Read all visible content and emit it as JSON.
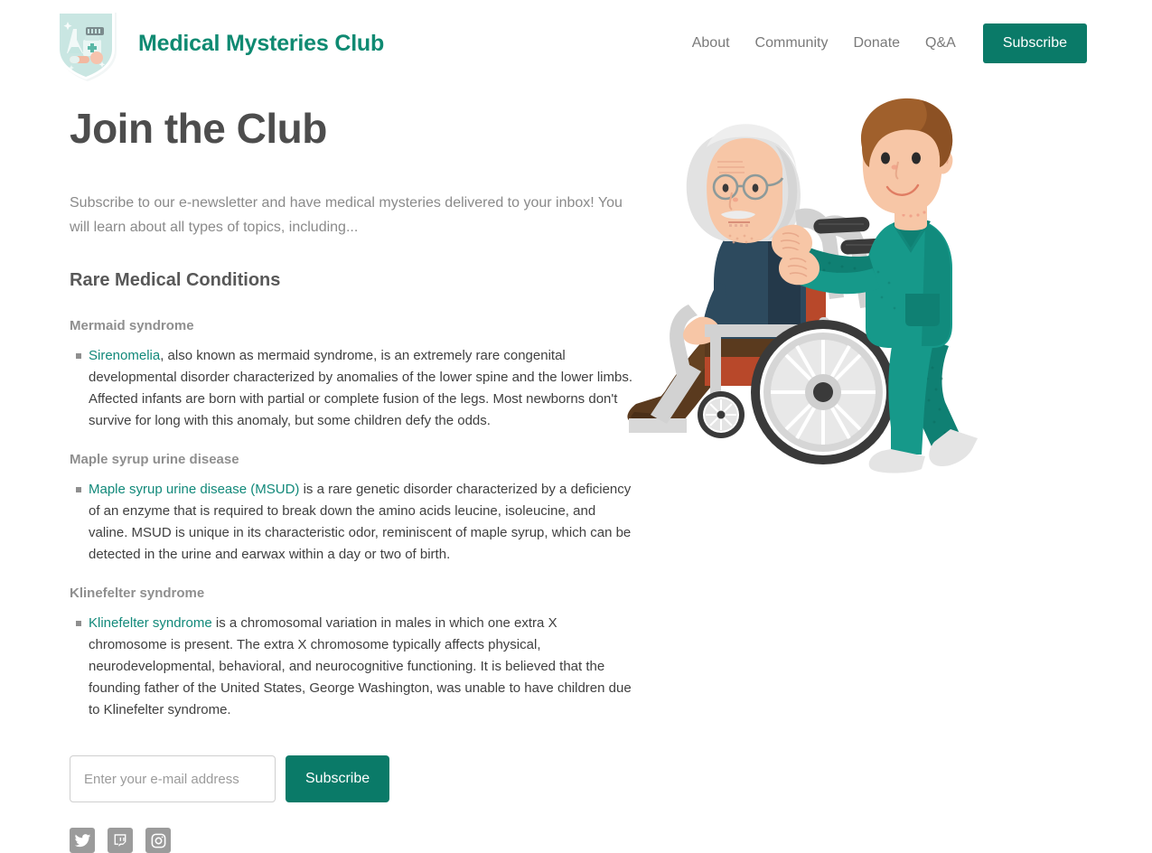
{
  "brand": {
    "name": "Medical Mysteries Club",
    "logo_icon": "medical-shield-badge-icon",
    "accent_color": "#0f8a72"
  },
  "nav": {
    "links": [
      {
        "label": "About"
      },
      {
        "label": "Community"
      },
      {
        "label": "Donate"
      },
      {
        "label": "Q&A"
      }
    ],
    "cta": {
      "label": "Subscribe",
      "bg_color": "#0a7a68",
      "text_color": "#ffffff"
    }
  },
  "main": {
    "title": "Join the Club",
    "lede": "Subscribe to our e-newsletter and have medical mysteries delivered to your inbox! You will learn about all types of topics, including...",
    "section_title": "Rare Medical Conditions",
    "conditions": [
      {
        "heading": "Mermaid syndrome",
        "link_text": "Sirenomelia",
        "body": ", also known as mermaid syndrome, is an extremely rare congenital developmental disorder characterized by anomalies of the lower spine and the lower limbs. Affected infants are born with partial or complete fusion of the legs. Most newborns don't survive for long with this anomaly, but some children defy the odds."
      },
      {
        "heading": "Maple syrup urine disease",
        "link_text": "Maple syrup urine disease (MSUD)",
        "body": " is a rare genetic disorder characterized by a deficiency of an enzyme that is required to break down the amino acids leucine, isoleucine, and valine. MSUD is unique in its characteristic odor, reminiscent of maple syrup, which can be detected in the urine and earwax within a day or two of birth."
      },
      {
        "heading": "Klinefelter syndrome",
        "link_text": "Klinefelter syndrome",
        "body": " is a chromosomal variation in males in which one extra X chromosome is present. The extra X chromosome typically affects physical, neurodevelopmental, behavioral, and neurocognitive functioning. It is believed that the founding father of the United States, George Washington, was unable to have children due to Klinefelter syndrome."
      }
    ],
    "link_color": "#12897a"
  },
  "signup": {
    "email_placeholder": "Enter your e-mail address",
    "email_value": "",
    "submit_label": "Subscribe"
  },
  "social": {
    "items": [
      {
        "icon": "twitter-icon",
        "name": "Twitter"
      },
      {
        "icon": "twitch-icon",
        "name": "Twitch"
      },
      {
        "icon": "instagram-icon",
        "name": "Instagram"
      }
    ],
    "icon_color": "#9b9b9b"
  },
  "illustration": {
    "name": "nurse-pushing-elderly-man-in-wheelchair-illustration",
    "colors": {
      "scrubs_teal": "#16998a",
      "scrubs_teal_dark": "#0f8073",
      "hair_brown": "#a0602c",
      "skin": "#f7c6a6",
      "sweater_navy": "#2d4a5e",
      "wheelchair_gray": "#d2d2d2",
      "seat_rust": "#b8482a",
      "trousers_brown": "#5a3a1e",
      "hair_white": "#e2e2e2",
      "tire_dark": "#3a3a3a"
    }
  }
}
